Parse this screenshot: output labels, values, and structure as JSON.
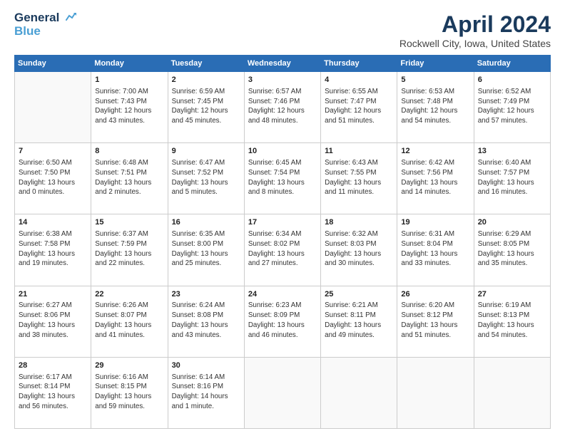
{
  "header": {
    "logo_line1": "General",
    "logo_line2": "Blue",
    "title": "April 2024",
    "subtitle": "Rockwell City, Iowa, United States"
  },
  "columns": [
    "Sunday",
    "Monday",
    "Tuesday",
    "Wednesday",
    "Thursday",
    "Friday",
    "Saturday"
  ],
  "weeks": [
    [
      {
        "day": "",
        "content": ""
      },
      {
        "day": "1",
        "content": "Sunrise: 7:00 AM\nSunset: 7:43 PM\nDaylight: 12 hours\nand 43 minutes."
      },
      {
        "day": "2",
        "content": "Sunrise: 6:59 AM\nSunset: 7:45 PM\nDaylight: 12 hours\nand 45 minutes."
      },
      {
        "day": "3",
        "content": "Sunrise: 6:57 AM\nSunset: 7:46 PM\nDaylight: 12 hours\nand 48 minutes."
      },
      {
        "day": "4",
        "content": "Sunrise: 6:55 AM\nSunset: 7:47 PM\nDaylight: 12 hours\nand 51 minutes."
      },
      {
        "day": "5",
        "content": "Sunrise: 6:53 AM\nSunset: 7:48 PM\nDaylight: 12 hours\nand 54 minutes."
      },
      {
        "day": "6",
        "content": "Sunrise: 6:52 AM\nSunset: 7:49 PM\nDaylight: 12 hours\nand 57 minutes."
      }
    ],
    [
      {
        "day": "7",
        "content": "Sunrise: 6:50 AM\nSunset: 7:50 PM\nDaylight: 13 hours\nand 0 minutes."
      },
      {
        "day": "8",
        "content": "Sunrise: 6:48 AM\nSunset: 7:51 PM\nDaylight: 13 hours\nand 2 minutes."
      },
      {
        "day": "9",
        "content": "Sunrise: 6:47 AM\nSunset: 7:52 PM\nDaylight: 13 hours\nand 5 minutes."
      },
      {
        "day": "10",
        "content": "Sunrise: 6:45 AM\nSunset: 7:54 PM\nDaylight: 13 hours\nand 8 minutes."
      },
      {
        "day": "11",
        "content": "Sunrise: 6:43 AM\nSunset: 7:55 PM\nDaylight: 13 hours\nand 11 minutes."
      },
      {
        "day": "12",
        "content": "Sunrise: 6:42 AM\nSunset: 7:56 PM\nDaylight: 13 hours\nand 14 minutes."
      },
      {
        "day": "13",
        "content": "Sunrise: 6:40 AM\nSunset: 7:57 PM\nDaylight: 13 hours\nand 16 minutes."
      }
    ],
    [
      {
        "day": "14",
        "content": "Sunrise: 6:38 AM\nSunset: 7:58 PM\nDaylight: 13 hours\nand 19 minutes."
      },
      {
        "day": "15",
        "content": "Sunrise: 6:37 AM\nSunset: 7:59 PM\nDaylight: 13 hours\nand 22 minutes."
      },
      {
        "day": "16",
        "content": "Sunrise: 6:35 AM\nSunset: 8:00 PM\nDaylight: 13 hours\nand 25 minutes."
      },
      {
        "day": "17",
        "content": "Sunrise: 6:34 AM\nSunset: 8:02 PM\nDaylight: 13 hours\nand 27 minutes."
      },
      {
        "day": "18",
        "content": "Sunrise: 6:32 AM\nSunset: 8:03 PM\nDaylight: 13 hours\nand 30 minutes."
      },
      {
        "day": "19",
        "content": "Sunrise: 6:31 AM\nSunset: 8:04 PM\nDaylight: 13 hours\nand 33 minutes."
      },
      {
        "day": "20",
        "content": "Sunrise: 6:29 AM\nSunset: 8:05 PM\nDaylight: 13 hours\nand 35 minutes."
      }
    ],
    [
      {
        "day": "21",
        "content": "Sunrise: 6:27 AM\nSunset: 8:06 PM\nDaylight: 13 hours\nand 38 minutes."
      },
      {
        "day": "22",
        "content": "Sunrise: 6:26 AM\nSunset: 8:07 PM\nDaylight: 13 hours\nand 41 minutes."
      },
      {
        "day": "23",
        "content": "Sunrise: 6:24 AM\nSunset: 8:08 PM\nDaylight: 13 hours\nand 43 minutes."
      },
      {
        "day": "24",
        "content": "Sunrise: 6:23 AM\nSunset: 8:09 PM\nDaylight: 13 hours\nand 46 minutes."
      },
      {
        "day": "25",
        "content": "Sunrise: 6:21 AM\nSunset: 8:11 PM\nDaylight: 13 hours\nand 49 minutes."
      },
      {
        "day": "26",
        "content": "Sunrise: 6:20 AM\nSunset: 8:12 PM\nDaylight: 13 hours\nand 51 minutes."
      },
      {
        "day": "27",
        "content": "Sunrise: 6:19 AM\nSunset: 8:13 PM\nDaylight: 13 hours\nand 54 minutes."
      }
    ],
    [
      {
        "day": "28",
        "content": "Sunrise: 6:17 AM\nSunset: 8:14 PM\nDaylight: 13 hours\nand 56 minutes."
      },
      {
        "day": "29",
        "content": "Sunrise: 6:16 AM\nSunset: 8:15 PM\nDaylight: 13 hours\nand 59 minutes."
      },
      {
        "day": "30",
        "content": "Sunrise: 6:14 AM\nSunset: 8:16 PM\nDaylight: 14 hours\nand 1 minute."
      },
      {
        "day": "",
        "content": ""
      },
      {
        "day": "",
        "content": ""
      },
      {
        "day": "",
        "content": ""
      },
      {
        "day": "",
        "content": ""
      }
    ]
  ]
}
